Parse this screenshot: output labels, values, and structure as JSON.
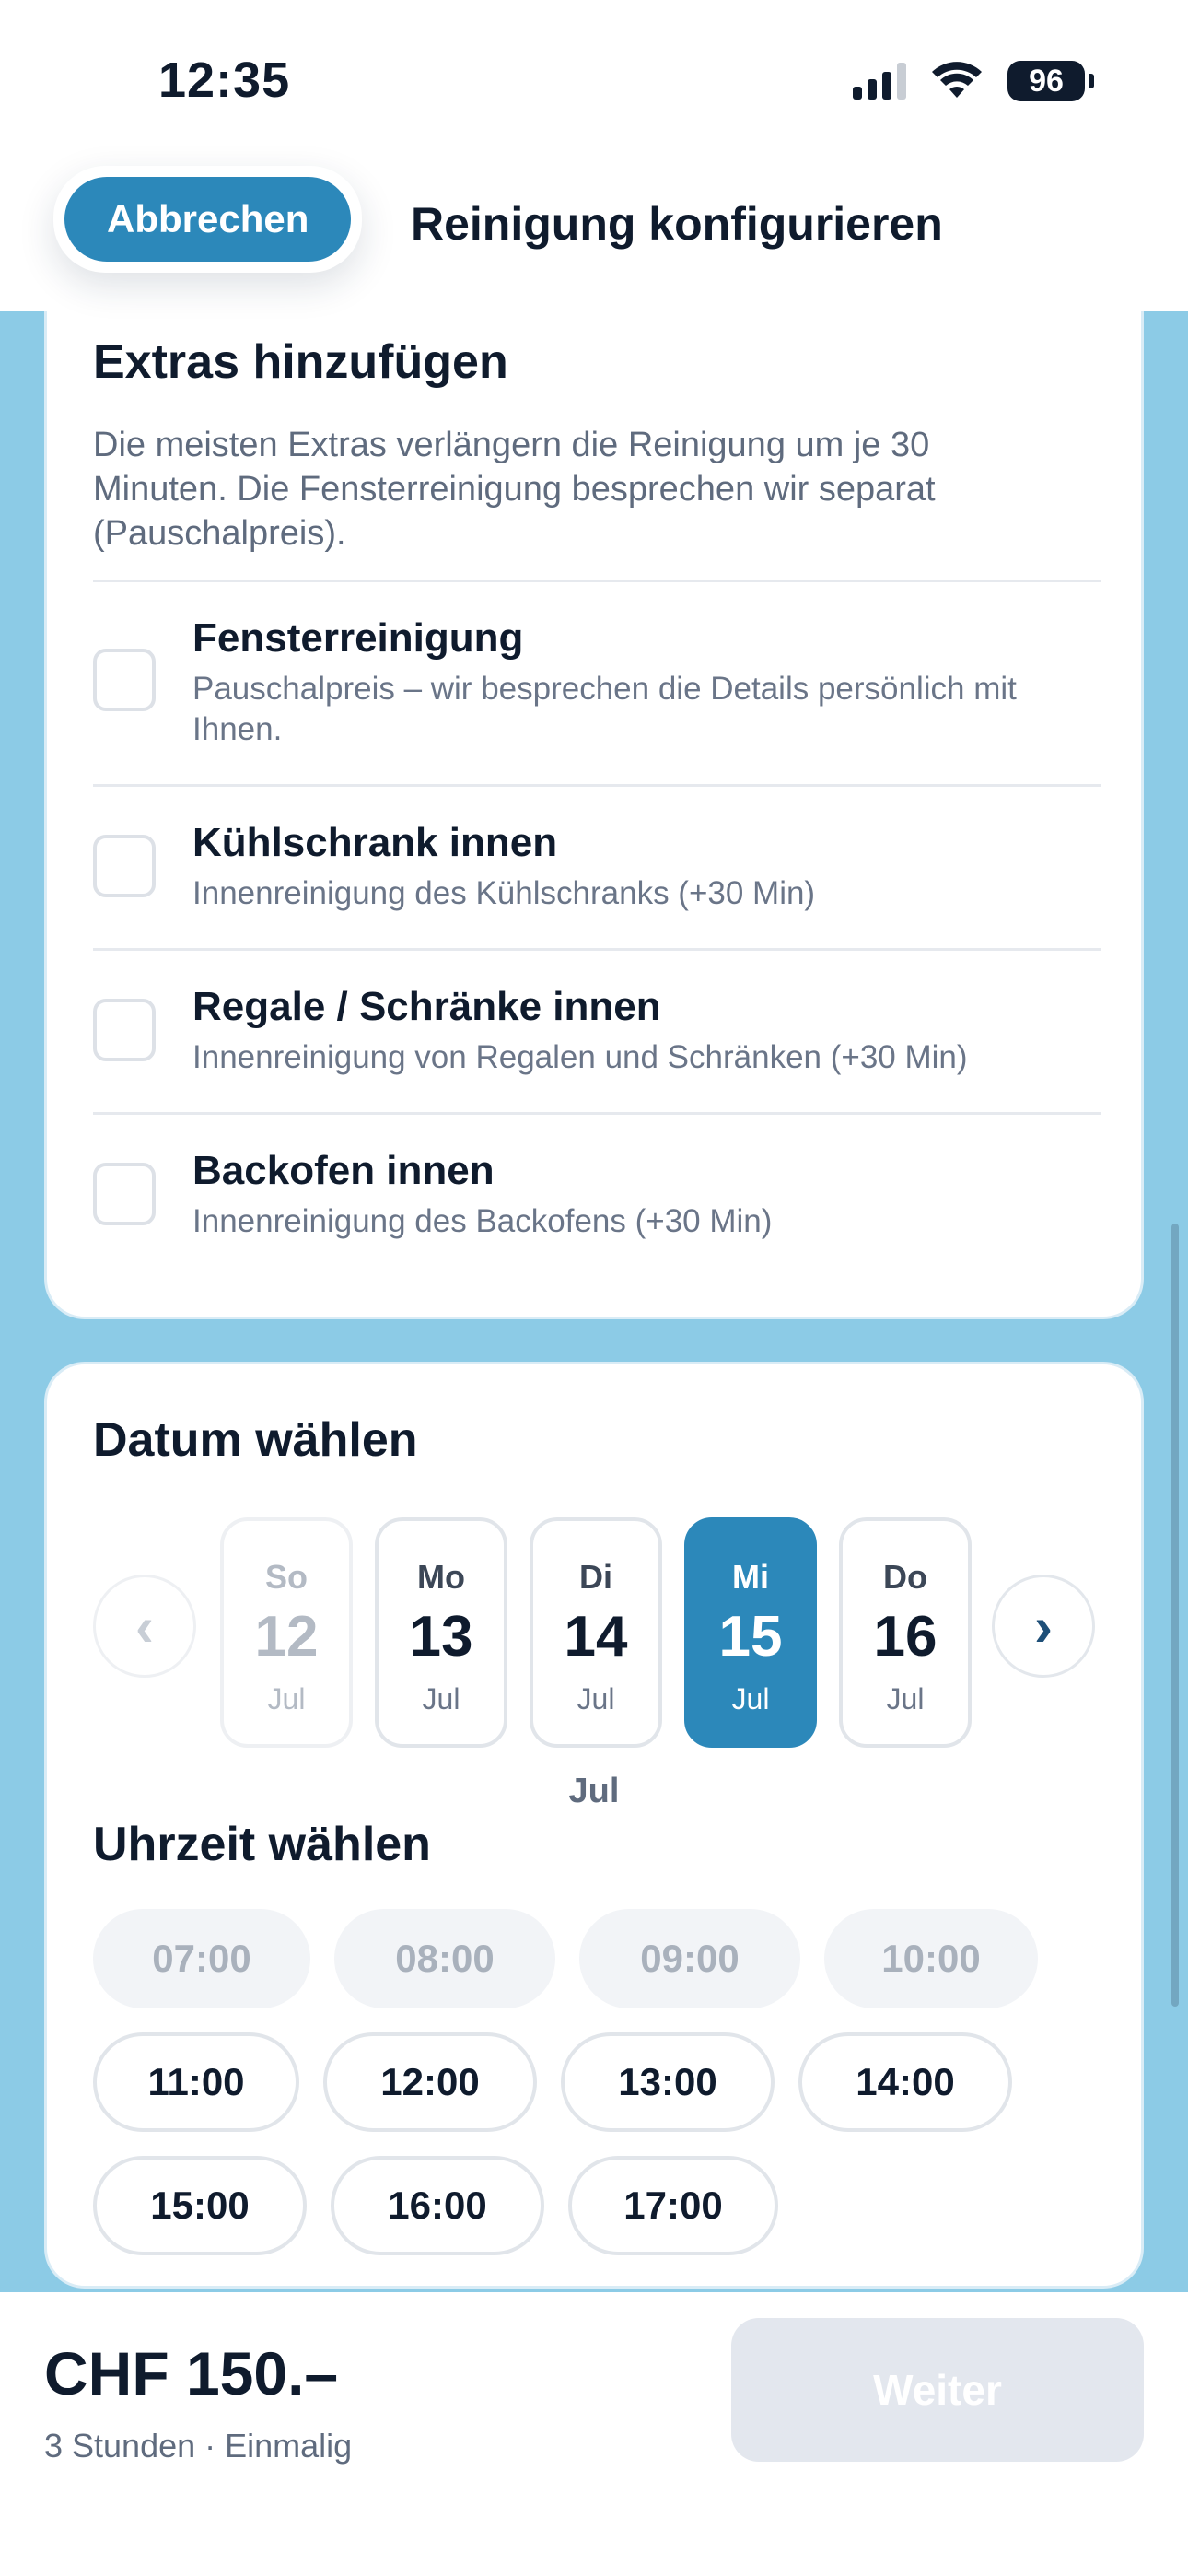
{
  "status_bar": {
    "time": "12:35",
    "battery": "96"
  },
  "header": {
    "cancel_label": "Abbrechen",
    "title": "Reinigung konfigurieren"
  },
  "extras": {
    "title": "Extras hinzufügen",
    "description": "Die meisten Extras verlängern die Reinigung um je 30 Minuten. Die Fensterreinigung besprechen wir separat (Pauschalpreis).",
    "items": [
      {
        "title": "Fensterreinigung",
        "subtitle": "Pauschalpreis – wir besprechen die Details persönlich mit Ihnen.",
        "checked": false
      },
      {
        "title": "Kühlschrank innen",
        "subtitle": "Innenreinigung des Kühlschranks (+30 Min)",
        "checked": false
      },
      {
        "title": "Regale / Schränke innen",
        "subtitle": "Innenreinigung von Regalen und Schränken (+30 Min)",
        "checked": false
      },
      {
        "title": "Backofen innen",
        "subtitle": "Innenreinigung des Backofens (+30 Min)",
        "checked": false
      }
    ]
  },
  "date": {
    "title": "Datum wählen",
    "prev_label": "‹",
    "next_label": "›",
    "days": [
      {
        "weekday": "So",
        "day": "12",
        "month": "Jul",
        "state": "disabled"
      },
      {
        "weekday": "Mo",
        "day": "13",
        "month": "Jul",
        "state": "normal"
      },
      {
        "weekday": "Di",
        "day": "14",
        "month": "Jul",
        "state": "normal"
      },
      {
        "weekday": "Mi",
        "day": "15",
        "month": "Jul",
        "state": "selected"
      },
      {
        "weekday": "Do",
        "day": "16",
        "month": "Jul",
        "state": "normal"
      }
    ],
    "current_month": "Jul"
  },
  "time": {
    "title": "Uhrzeit wählen",
    "slots": [
      {
        "label": "07:00",
        "state": "disabled"
      },
      {
        "label": "08:00",
        "state": "disabled"
      },
      {
        "label": "09:00",
        "state": "disabled"
      },
      {
        "label": "10:00",
        "state": "disabled"
      },
      {
        "label": "11:00",
        "state": "normal"
      },
      {
        "label": "12:00",
        "state": "normal"
      },
      {
        "label": "13:00",
        "state": "normal"
      },
      {
        "label": "14:00",
        "state": "normal"
      },
      {
        "label": "15:00",
        "state": "normal"
      },
      {
        "label": "16:00",
        "state": "normal"
      },
      {
        "label": "17:00",
        "state": "normal"
      }
    ]
  },
  "footer": {
    "price": "CHF 150.–",
    "subtitle": "3 Stunden · Einmalig",
    "next_label": "Weiter"
  },
  "colors": {
    "accent": "#2c88ba",
    "background": "#8ccbe6",
    "text": "#0f1b2d",
    "muted": "#5f6b7e",
    "disabled_button": "#e3e7ee"
  }
}
